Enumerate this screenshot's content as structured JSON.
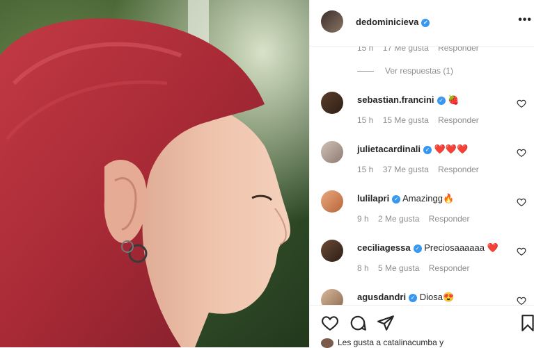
{
  "post": {
    "author": "dedominicieva",
    "more_label": "•••"
  },
  "top_meta": {
    "time": "15 h",
    "likes": "17 Me gusta",
    "reply": "Responder"
  },
  "view_replies": "Ver respuestas (1)",
  "comments": [
    {
      "user": "sebastian.francini",
      "text": "🍓",
      "time": "15 h",
      "likes": "15 Me gusta",
      "reply": "Responder"
    },
    {
      "user": "julietacardinali",
      "text": "❤️❤️❤️",
      "time": "15 h",
      "likes": "37 Me gusta",
      "reply": "Responder"
    },
    {
      "user": "lulilapri",
      "text": "Amazingg🔥",
      "time": "9 h",
      "likes": "2 Me gusta",
      "reply": "Responder"
    },
    {
      "user": "ceciliagessa",
      "text": "Preciosaaaaaa ❤️",
      "time": "8 h",
      "likes": "5 Me gusta",
      "reply": "Responder"
    },
    {
      "user": "agusdandri",
      "text": "Diosa😍",
      "time": "",
      "likes": "",
      "reply": ""
    }
  ],
  "likes_line": "Les gusta a catalinacumba y",
  "colors": {
    "verified": "#3897f0",
    "hair": "#b3303a",
    "text_secondary": "#8e8e8e"
  },
  "icons": [
    "heart-icon",
    "comment-icon",
    "share-icon",
    "bookmark-icon",
    "more-icon",
    "verified-icon"
  ]
}
